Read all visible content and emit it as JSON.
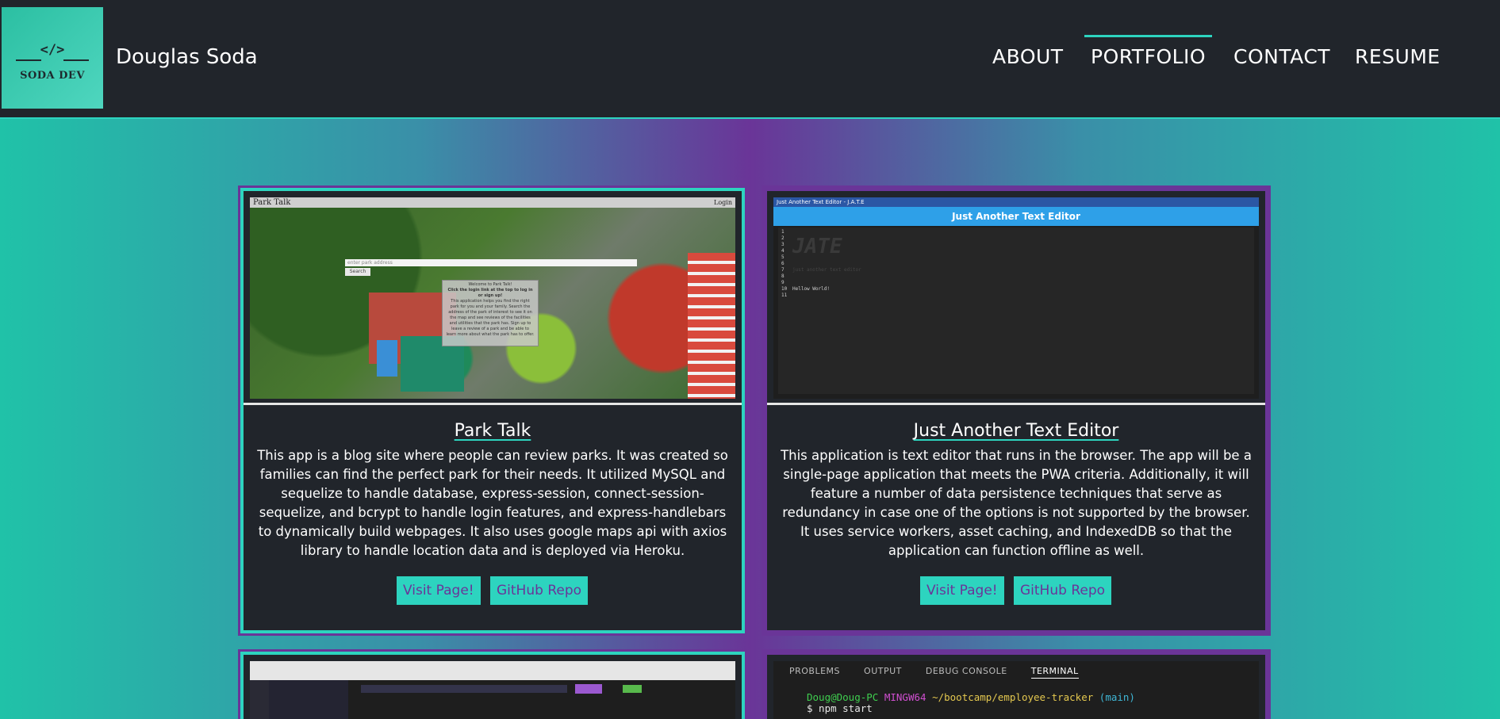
{
  "header": {
    "logo_code": "</>",
    "logo_text": "SODA DEV",
    "name": "Douglas Soda",
    "nav": [
      {
        "label": "ABOUT"
      },
      {
        "label": "PORTFOLIO",
        "active": true
      },
      {
        "label": "CONTACT"
      },
      {
        "label": "RESUME"
      }
    ]
  },
  "projects": [
    {
      "title": "Park Talk",
      "description": "This app is a blog site where people can review parks. It was created so families can find the perfect park for their needs. It utilized MySQL and sequelize to handle database, express-session, connect-session-sequelize, and bcrypt to handle login features, and express-handlebars to dynamically build webpages. It also uses google maps api with axios library to handle location data and is deployed via Heroku.",
      "visit_label": "Visit Page!",
      "repo_label": "GitHub Repo",
      "screenshot": {
        "app_title": "Park Talk",
        "login": "Login",
        "search_placeholder": "enter park address",
        "search_button": "Search",
        "modal_title": "Welcome to Park Talk!",
        "modal_subtitle": "Click the login link at the top to log in or sign up!",
        "modal_body": "This application helps you find the right park for you and your family. Search the address of the park of interest to see it on the map and see reviews of the facilities and utilities that the park has. Sign up to leave a review of a park and be able to learn more about what the park has to offer."
      }
    },
    {
      "title": "Just Another Text Editor",
      "description": "This application is text editor that runs in the browser. The app will be a single-page application that meets the PWA criteria. Additionally, it will feature a number of data persistence techniques that serve as redundancy in case one of the options is not supported by the browser. It uses service workers, asset caching, and IndexedDB so that the application can function offline as well.",
      "visit_label": "Visit Page!",
      "repo_label": "GitHub Repo",
      "screenshot": {
        "window_title": "Just Another Text Editor - J.A.T.E",
        "header": "Just Another Text Editor",
        "art": "JATE",
        "line_numbers": [
          "1",
          "2",
          "3",
          "4",
          "5",
          "6",
          "7",
          "8",
          "9",
          "10",
          "11"
        ],
        "subtitle": "just another text editor",
        "code_line": "Hellow World!"
      }
    }
  ],
  "partial_screens": {
    "terminal": {
      "tabs": [
        "PROBLEMS",
        "OUTPUT",
        "DEBUG CONSOLE",
        "TERMINAL"
      ],
      "active_tab": "TERMINAL",
      "prompt_user": "Doug@Doug-PC",
      "prompt_env": "MINGW64",
      "prompt_path": "~/bootcamp/employee-tracker",
      "prompt_branch": "(main)",
      "command": "$ npm start"
    }
  },
  "colors": {
    "teal": "#2dd4bf",
    "purple": "#6a3598",
    "dark": "#21252b"
  }
}
